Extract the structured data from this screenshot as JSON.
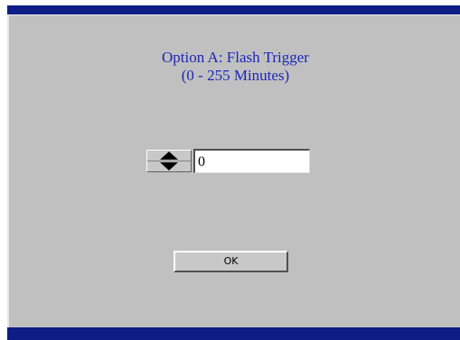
{
  "dialog": {
    "title_line1": "Option A: Flash Trigger",
    "title_line2": "(0 - 255 Minutes)",
    "value": "0",
    "ok_label": "OK"
  },
  "colors": {
    "title_bar": "#0c1e86",
    "panel_background": "#c0c0c0",
    "title_text": "#1a26b8"
  },
  "icons": {
    "spinner_up": "triangle-up-icon",
    "spinner_down": "triangle-down-icon"
  }
}
